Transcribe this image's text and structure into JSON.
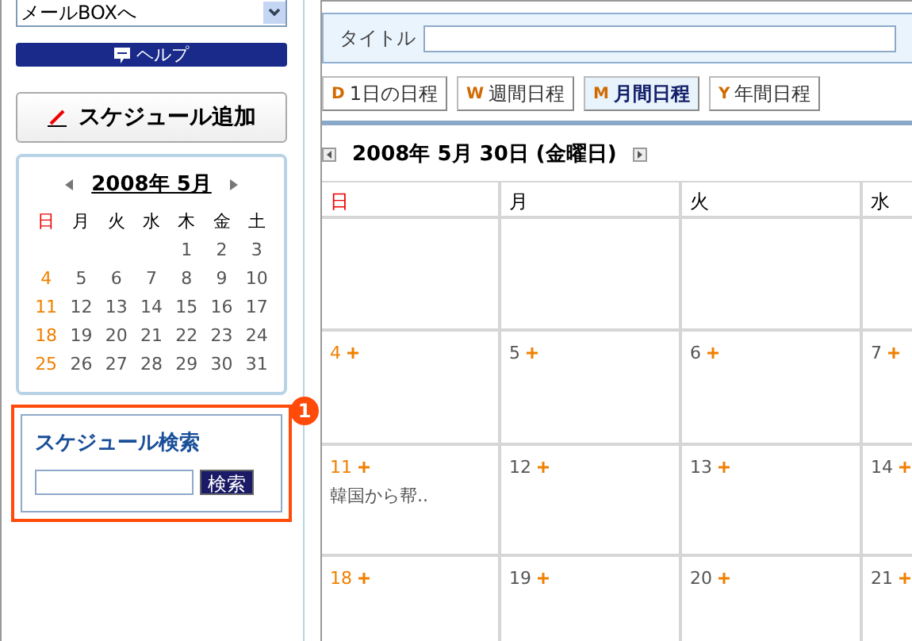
{
  "sidebar": {
    "dropdown": {
      "value": "メールBOXへ"
    },
    "help_button": "ヘルプ",
    "add_button": "スケジュール追加",
    "mini_calendar": {
      "title": "2008年 5月",
      "weekdays": [
        {
          "label": "日",
          "kind": "sunday"
        },
        {
          "label": "月",
          "kind": "weekday"
        },
        {
          "label": "火",
          "kind": "weekday"
        },
        {
          "label": "水",
          "kind": "weekday"
        },
        {
          "label": "木",
          "kind": "weekday"
        },
        {
          "label": "金",
          "kind": "weekday"
        },
        {
          "label": "土",
          "kind": "weekday"
        }
      ],
      "weeks": [
        [
          "1",
          "2",
          "3"
        ],
        [
          "4",
          "5",
          "6",
          "7",
          "8",
          "9",
          "10"
        ],
        [
          "11",
          "12",
          "13",
          "14",
          "15",
          "16",
          "17"
        ],
        [
          "18",
          "19",
          "20",
          "21",
          "22",
          "23",
          "24"
        ],
        [
          "25",
          "26",
          "27",
          "28",
          "29",
          "30",
          "31"
        ]
      ]
    },
    "search": {
      "title": "スケジュール検索",
      "button": "検索",
      "callout": "1"
    }
  },
  "main": {
    "title_field": {
      "label": "タイトル"
    },
    "tabs": [
      {
        "letter": "D",
        "label": "1日の日程",
        "selected": false
      },
      {
        "letter": "W",
        "label": "週間日程",
        "selected": false
      },
      {
        "letter": "M",
        "label": "月間日程",
        "selected": true
      },
      {
        "letter": "Y",
        "label": "年間日程",
        "selected": false
      }
    ],
    "date": "2008年 5月 30日 (金曜日)",
    "calendar": {
      "columns": [
        {
          "label": "日",
          "kind": "sunday"
        },
        {
          "label": "月",
          "kind": "weekday"
        },
        {
          "label": "火",
          "kind": "weekday"
        },
        {
          "label": "水",
          "kind": "weekday"
        }
      ],
      "rows": [
        [
          {
            "kind": "blank"
          },
          {
            "kind": "blank"
          },
          {
            "kind": "blank"
          },
          {
            "kind": "blank"
          }
        ],
        [
          {
            "kind": "day",
            "day": "4"
          },
          {
            "kind": "day",
            "day": "5"
          },
          {
            "kind": "day",
            "day": "6"
          },
          {
            "kind": "day",
            "day": "7"
          }
        ],
        [
          {
            "kind": "day",
            "day": "11",
            "events": [
              "韓国から帮.."
            ]
          },
          {
            "kind": "day",
            "day": "12"
          },
          {
            "kind": "day",
            "day": "13"
          },
          {
            "kind": "day",
            "day": "14"
          }
        ],
        [
          {
            "kind": "day",
            "day": "18"
          },
          {
            "kind": "day",
            "day": "19"
          },
          {
            "kind": "day",
            "day": "20"
          },
          {
            "kind": "day",
            "day": "21"
          }
        ]
      ]
    }
  }
}
